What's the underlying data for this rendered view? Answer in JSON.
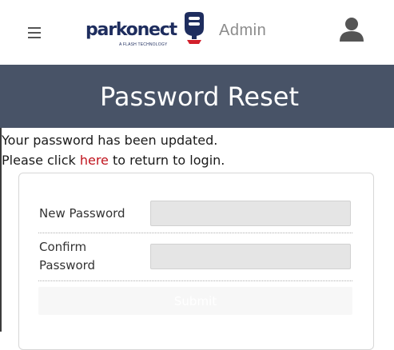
{
  "header": {
    "logo_text": "parkonect",
    "logo_tagline": "A FLASH TECHNOLOGY",
    "admin_label": "Admin",
    "menu_icon": "hamburger-menu-icon",
    "user_icon": "user-icon"
  },
  "page": {
    "title": "Password Reset"
  },
  "message": {
    "line1": "Your password has been updated.",
    "line2_before": "Please click ",
    "line2_link": "here",
    "line2_after": " to return to login."
  },
  "form": {
    "new_password_label": "New Password",
    "new_password_value": "",
    "confirm_password_label_line1": "Confirm",
    "confirm_password_label_line2": "Password",
    "confirm_password_value": "",
    "submit_label": "Submit"
  },
  "colors": {
    "brand_navy": "#1e2d5e",
    "banner_bg": "#485367",
    "link_red": "#c0141e",
    "admin_gray": "#8c8c8c"
  }
}
